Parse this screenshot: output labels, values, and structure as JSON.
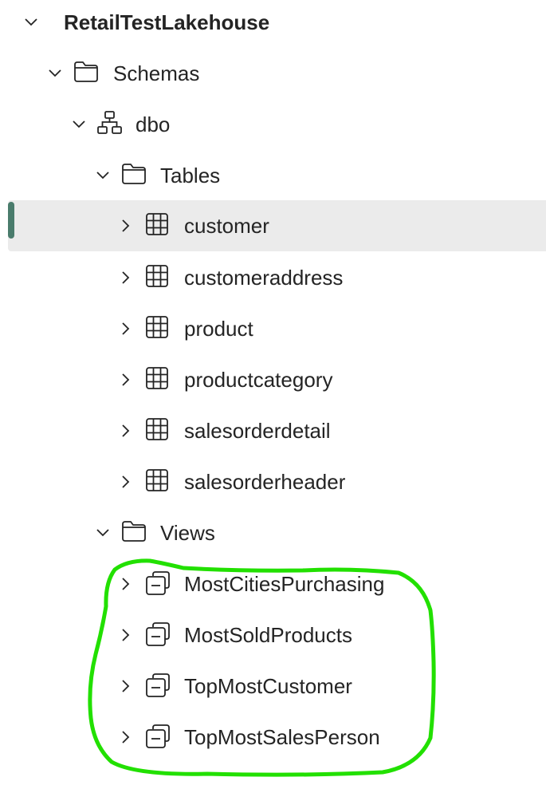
{
  "tree": {
    "root": {
      "label": "RetailTestLakehouse",
      "expanded": true
    },
    "schemas": {
      "label": "Schemas",
      "expanded": true,
      "icon": "folder-icon"
    },
    "dbo": {
      "label": "dbo",
      "expanded": true,
      "icon": "schema-hierarchy-icon"
    },
    "tables_folder": {
      "label": "Tables",
      "expanded": true,
      "icon": "folder-icon"
    },
    "tables": [
      {
        "label": "customer",
        "selected": true,
        "icon": "table-icon"
      },
      {
        "label": "customeraddress",
        "icon": "table-icon"
      },
      {
        "label": "product",
        "icon": "table-icon"
      },
      {
        "label": "productcategory",
        "icon": "table-icon"
      },
      {
        "label": "salesorderdetail",
        "icon": "table-icon"
      },
      {
        "label": "salesorderheader",
        "icon": "table-icon"
      }
    ],
    "views_folder": {
      "label": "Views",
      "expanded": true,
      "icon": "folder-icon"
    },
    "views": [
      {
        "label": "MostCitiesPurchasing",
        "icon": "view-icon"
      },
      {
        "label": "MostSoldProducts",
        "icon": "view-icon"
      },
      {
        "label": "TopMostCustomer",
        "icon": "view-icon"
      },
      {
        "label": "TopMostSalesPerson",
        "icon": "view-icon"
      }
    ]
  },
  "colors": {
    "selection_bg": "#ebebeb",
    "selection_indicator": "#4a7c6c",
    "annotation": "#22e000",
    "text": "#242424"
  }
}
